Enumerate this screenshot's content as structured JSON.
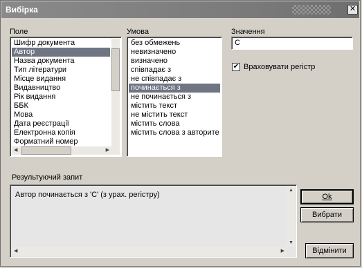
{
  "window": {
    "title": "Вибірка"
  },
  "field_list": {
    "label": "Поле",
    "items": [
      "Шифр документа",
      "Автор",
      "Назва документа",
      "Тип літератури",
      "Місце видання",
      "Видавництво",
      "Рік видання",
      "ББК",
      "Мова",
      "Дата реєстрації",
      "Електронна копія",
      "Форматний номер"
    ],
    "selected": "Автор"
  },
  "condition_list": {
    "label": "Умова",
    "items": [
      "без обмежень",
      "невизначено",
      "визначено",
      "співпадає з",
      "не співпадає з",
      "починається з",
      "не починається з",
      "містить текст",
      "не містить текст",
      "містить слова",
      "містить слова з авторите"
    ],
    "selected": "починається з"
  },
  "value": {
    "label": "Значення",
    "input_value": "С"
  },
  "case_checkbox": {
    "label": "Враховувати регістр",
    "checked": true,
    "mark": "✔"
  },
  "result": {
    "label": "Результуючий запит",
    "text": "Автор починається з 'С' (з урах. регістру)"
  },
  "buttons": {
    "ok": "Ok",
    "select": "Вибрати",
    "cancel": "Відмінити",
    "close_glyph": "✕"
  }
}
